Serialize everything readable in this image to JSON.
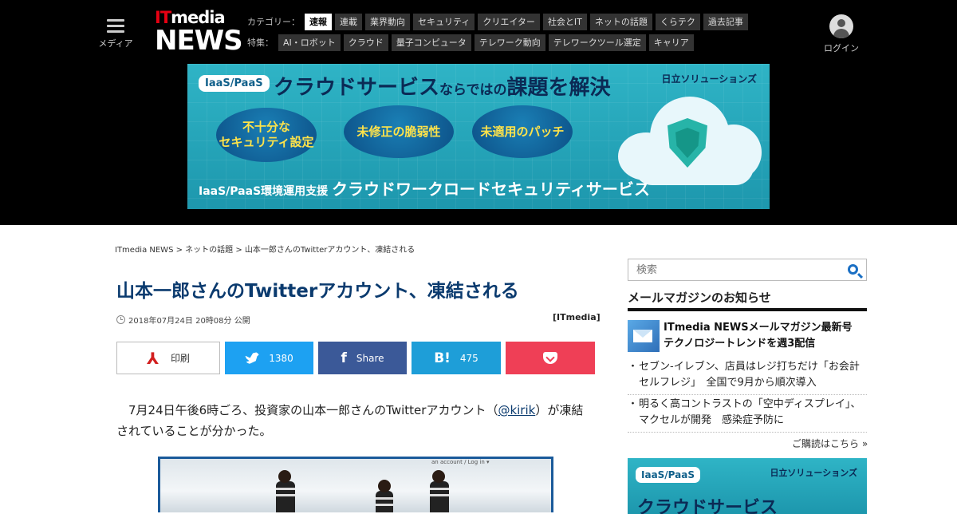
{
  "header": {
    "menu_label": "メディア",
    "logo_top_it": "IT",
    "logo_top_rest": "media",
    "logo_news": "NEWS",
    "login_label": "ログイン",
    "category_head": "カテゴリー：",
    "categories": [
      "速報",
      "連載",
      "業界動向",
      "セキュリティ",
      "クリエイター",
      "社会とIT",
      "ネットの話題",
      "くらテク",
      "過去記事"
    ],
    "feature_head": "特集：",
    "features": [
      "AI・ロボット",
      "クラウド",
      "量子コンピュータ",
      "テレワーク動向",
      "テレワークツール選定",
      "キャリア"
    ]
  },
  "banner": {
    "tag": "IaaS/PaaS",
    "headline_a": "クラウドサービス",
    "headline_b": "ならではの",
    "headline_c": "課題を解決",
    "maker": "日立ソリューションズ",
    "bubble1": "不十分な\nセキュリティ設定",
    "bubble2": "未修正の脆弱性",
    "bubble3": "未適用のパッチ",
    "bottom_a": "IaaS/PaaS環境運用支援",
    "bottom_b": "クラウドワークロードセキュリティサービス"
  },
  "article": {
    "breadcrumb": "ITmedia NEWS > ネットの話題 > 山本一郎さんのTwitterアカウント、凍結される",
    "title": "山本一郎さんのTwitterアカウント、凍結される",
    "date": "2018年07月24日 20時08分 公開",
    "source": "[ITmedia]",
    "body_before": "　7月24日午後6時ごろ、投資家の山本一郎さんのTwitterアカウント（",
    "body_link": "@kirik",
    "body_after": "）が凍結されていることが分かった。",
    "photo_ui_text": "an account / Log in ▾"
  },
  "share": {
    "print_label": "印刷",
    "twitter_count": "1380",
    "facebook_label": "Share",
    "hatena_count": "475",
    "colors": {
      "twitter": "#1da1f2",
      "facebook": "#3b5998",
      "hatena": "#1e9ed8",
      "pocket": "#ef3f56"
    }
  },
  "sidebar": {
    "search_placeholder": "検索",
    "mailmag_head": "メールマガジンのお知らせ",
    "mailmag_feature": "ITmedia NEWSメールマガジン最新号\nテクノロジートレンドを週3配信",
    "mailmag_items": [
      "セブン-イレブン、店員はレジ打ちだけ「お会計セルフレジ」　全国で9月から順次導入",
      "明るく高コントラストの「空中ディスプレイ」、マクセルが開発　感染症予防に"
    ],
    "more_link": "ご購読はこちら »",
    "ad_tag": "IaaS/PaaS",
    "ad_maker": "日立ソリューションズ",
    "ad_text": "クラウドサービス"
  }
}
